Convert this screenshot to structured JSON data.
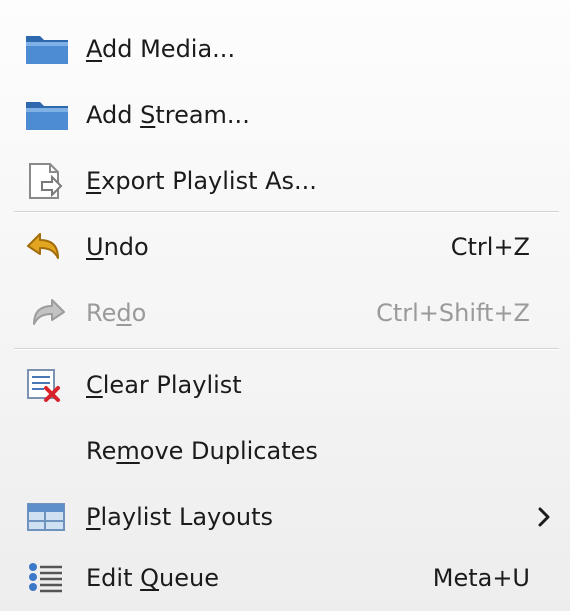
{
  "menu": {
    "items": [
      {
        "label_pre": "",
        "mnemonic": "A",
        "label_post": "dd Media...",
        "shortcut": "",
        "icon": "folder-icon",
        "enabled": true
      },
      {
        "label_pre": "Add ",
        "mnemonic": "S",
        "label_post": "tream...",
        "shortcut": "",
        "icon": "folder-icon",
        "enabled": true
      },
      {
        "label_pre": "",
        "mnemonic": "E",
        "label_post": "xport Playlist As...",
        "shortcut": "",
        "icon": "export-document-icon",
        "enabled": true
      },
      {
        "label_pre": "",
        "mnemonic": "U",
        "label_post": "ndo",
        "shortcut": "Ctrl+Z",
        "icon": "undo-icon",
        "enabled": true
      },
      {
        "label_pre": "Re",
        "mnemonic": "d",
        "label_post": "o",
        "shortcut": "Ctrl+Shift+Z",
        "icon": "redo-icon",
        "enabled": false
      },
      {
        "label_pre": "",
        "mnemonic": "C",
        "label_post": "lear Playlist",
        "shortcut": "",
        "icon": "clear-playlist-icon",
        "enabled": true
      },
      {
        "label_pre": "Re",
        "mnemonic": "m",
        "label_post": "ove Duplicates",
        "shortcut": "",
        "icon": "",
        "enabled": true
      },
      {
        "label_pre": "",
        "mnemonic": "P",
        "label_post": "laylist Layouts",
        "shortcut": "",
        "icon": "playlist-layout-icon",
        "enabled": true,
        "submenu": true
      },
      {
        "label_pre": "Edit ",
        "mnemonic": "Q",
        "label_post": "ueue",
        "shortcut": "Meta+U",
        "icon": "queue-list-icon",
        "enabled": true
      }
    ],
    "colors": {
      "text": "#1b1b1b",
      "disabled_text": "#9a9a9a",
      "folder_blue": "#3f7cc4",
      "undo_gold": "#e0a21c",
      "clear_red": "#d8232a"
    }
  }
}
